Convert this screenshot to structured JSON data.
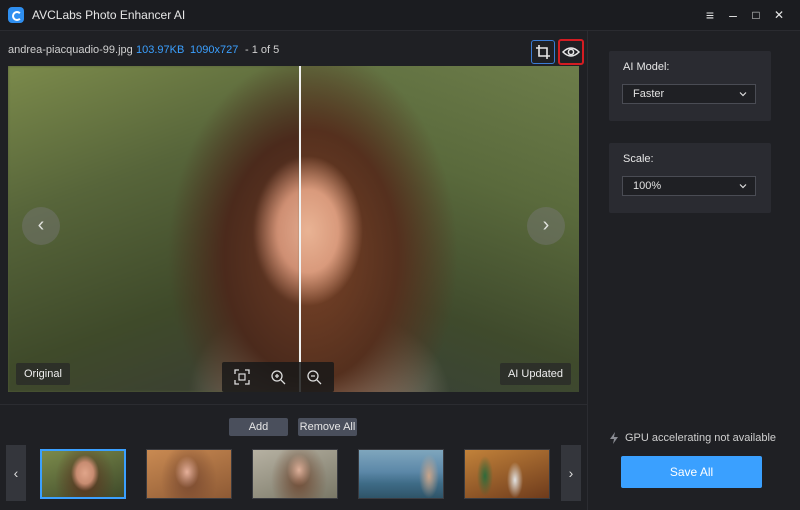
{
  "app": {
    "title": "AVCLabs Photo Enhancer AI"
  },
  "window_controls": {
    "menu": "≡",
    "minimize": "–",
    "maximize": "□",
    "close": "✕"
  },
  "file_info": {
    "filename": "andrea-piacquadio-99.jpg",
    "size": "103.97KB",
    "dimensions": "1090x727",
    "page": "- 1 of 5"
  },
  "preview": {
    "label_original": "Original",
    "label_updated": "AI Updated",
    "prev_arrow": "‹",
    "next_arrow": "›"
  },
  "toolbar": {
    "add_label": "Add",
    "remove_all_label": "Remove All"
  },
  "thumbnails": {
    "prev": "‹",
    "next": "›",
    "selected_index": 0,
    "count": 5
  },
  "sidebar": {
    "ai_model": {
      "label": "AI Model:",
      "value": "Faster"
    },
    "scale": {
      "label": "Scale:",
      "value": "100%"
    },
    "gpu_status": "GPU accelerating not available",
    "save_all_label": "Save All"
  },
  "colors": {
    "accent": "#3aa0ff",
    "highlight_border": "#d41c22",
    "background": "#1f2024",
    "panel": "#2a2b31"
  }
}
